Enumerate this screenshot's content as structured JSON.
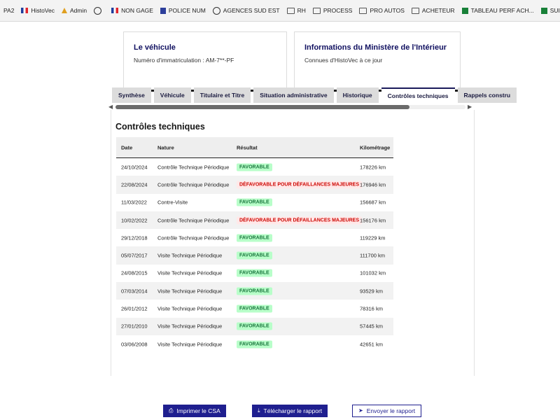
{
  "bookmarks": [
    {
      "label": "PA2",
      "icon": "none"
    },
    {
      "label": "HistoVec",
      "icon": "flag-icon"
    },
    {
      "label": "Admin",
      "icon": "warning-icon"
    },
    {
      "label": "",
      "icon": "globe-icon"
    },
    {
      "label": "NON GAGE",
      "icon": "flag-icon"
    },
    {
      "label": "POLICE NUM",
      "icon": "document-icon"
    },
    {
      "label": "AGENCES SUD EST",
      "icon": "globe-icon"
    },
    {
      "label": "RH",
      "icon": "folder-icon"
    },
    {
      "label": "PROCESS",
      "icon": "folder-icon"
    },
    {
      "label": "PRO AUTOS",
      "icon": "folder-icon"
    },
    {
      "label": "ACHETEUR",
      "icon": "folder-icon"
    },
    {
      "label": "TABLEAU PERF ACH...",
      "icon": "sheet-icon"
    },
    {
      "label": "SUIVI PERF ACHETE...",
      "icon": "sheet-icon"
    }
  ],
  "vehicle_card": {
    "title": "Le véhicule",
    "subtitle": "Numéro d'immatriculation : AM-7**-PF"
  },
  "ministry_card": {
    "title": "Informations du Ministère de l'Intérieur",
    "subtitle": "Connues d'HistoVec à ce jour"
  },
  "tabs": [
    "Synthèse",
    "Véhicule",
    "Titulaire et Titre",
    "Situation administrative",
    "Historique",
    "Contrôles techniques",
    "Rappels constru"
  ],
  "active_tab": "Contrôles techniques",
  "section_title": "Contrôles techniques",
  "table": {
    "headers": {
      "date": "Date",
      "nature": "Nature",
      "result": "Résultat",
      "km": "Kilométrage"
    },
    "rows": [
      {
        "date": "24/10/2024",
        "nature": "Contrôle Technique Périodique",
        "result": "FAVORABLE",
        "status": "ok",
        "km": "178226 km"
      },
      {
        "date": "22/08/2024",
        "nature": "Contrôle Technique Périodique",
        "result": "DÉFAVORABLE POUR DÉFAILLANCES MAJEURES",
        "status": "ko",
        "km": "176946 km"
      },
      {
        "date": "11/03/2022",
        "nature": "Contre-Visite",
        "result": "FAVORABLE",
        "status": "ok",
        "km": "156687 km"
      },
      {
        "date": "10/02/2022",
        "nature": "Contrôle Technique Périodique",
        "result": "DÉFAVORABLE POUR DÉFAILLANCES MAJEURES",
        "status": "ko",
        "km": "156176 km"
      },
      {
        "date": "29/12/2018",
        "nature": "Contrôle Technique Périodique",
        "result": "FAVORABLE",
        "status": "ok",
        "km": "119229 km"
      },
      {
        "date": "05/07/2017",
        "nature": "Visite Technique Périodique",
        "result": "FAVORABLE",
        "status": "ok",
        "km": "111700 km"
      },
      {
        "date": "24/08/2015",
        "nature": "Visite Technique Périodique",
        "result": "FAVORABLE",
        "status": "ok",
        "km": "101032 km"
      },
      {
        "date": "07/03/2014",
        "nature": "Visite Technique Périodique",
        "result": "FAVORABLE",
        "status": "ok",
        "km": "93529 km"
      },
      {
        "date": "26/01/2012",
        "nature": "Visite Technique Périodique",
        "result": "FAVORABLE",
        "status": "ok",
        "km": "78316 km"
      },
      {
        "date": "27/01/2010",
        "nature": "Visite Technique Périodique",
        "result": "FAVORABLE",
        "status": "ok",
        "km": "57445 km"
      },
      {
        "date": "03/06/2008",
        "nature": "Visite Technique Périodique",
        "result": "FAVORABLE",
        "status": "ok",
        "km": "42651 km"
      }
    ]
  },
  "buttons": {
    "print": "Imprimer le CSA",
    "download": "Télécharger le rapport",
    "send": "Envoyer le rapport"
  },
  "colors": {
    "primary": "#1f1f8f",
    "favorable_bg": "#b8fec9",
    "favorable_text": "#18753c",
    "unfavorable_bg": "#ffe9e9",
    "unfavorable_text": "#ce0500"
  }
}
